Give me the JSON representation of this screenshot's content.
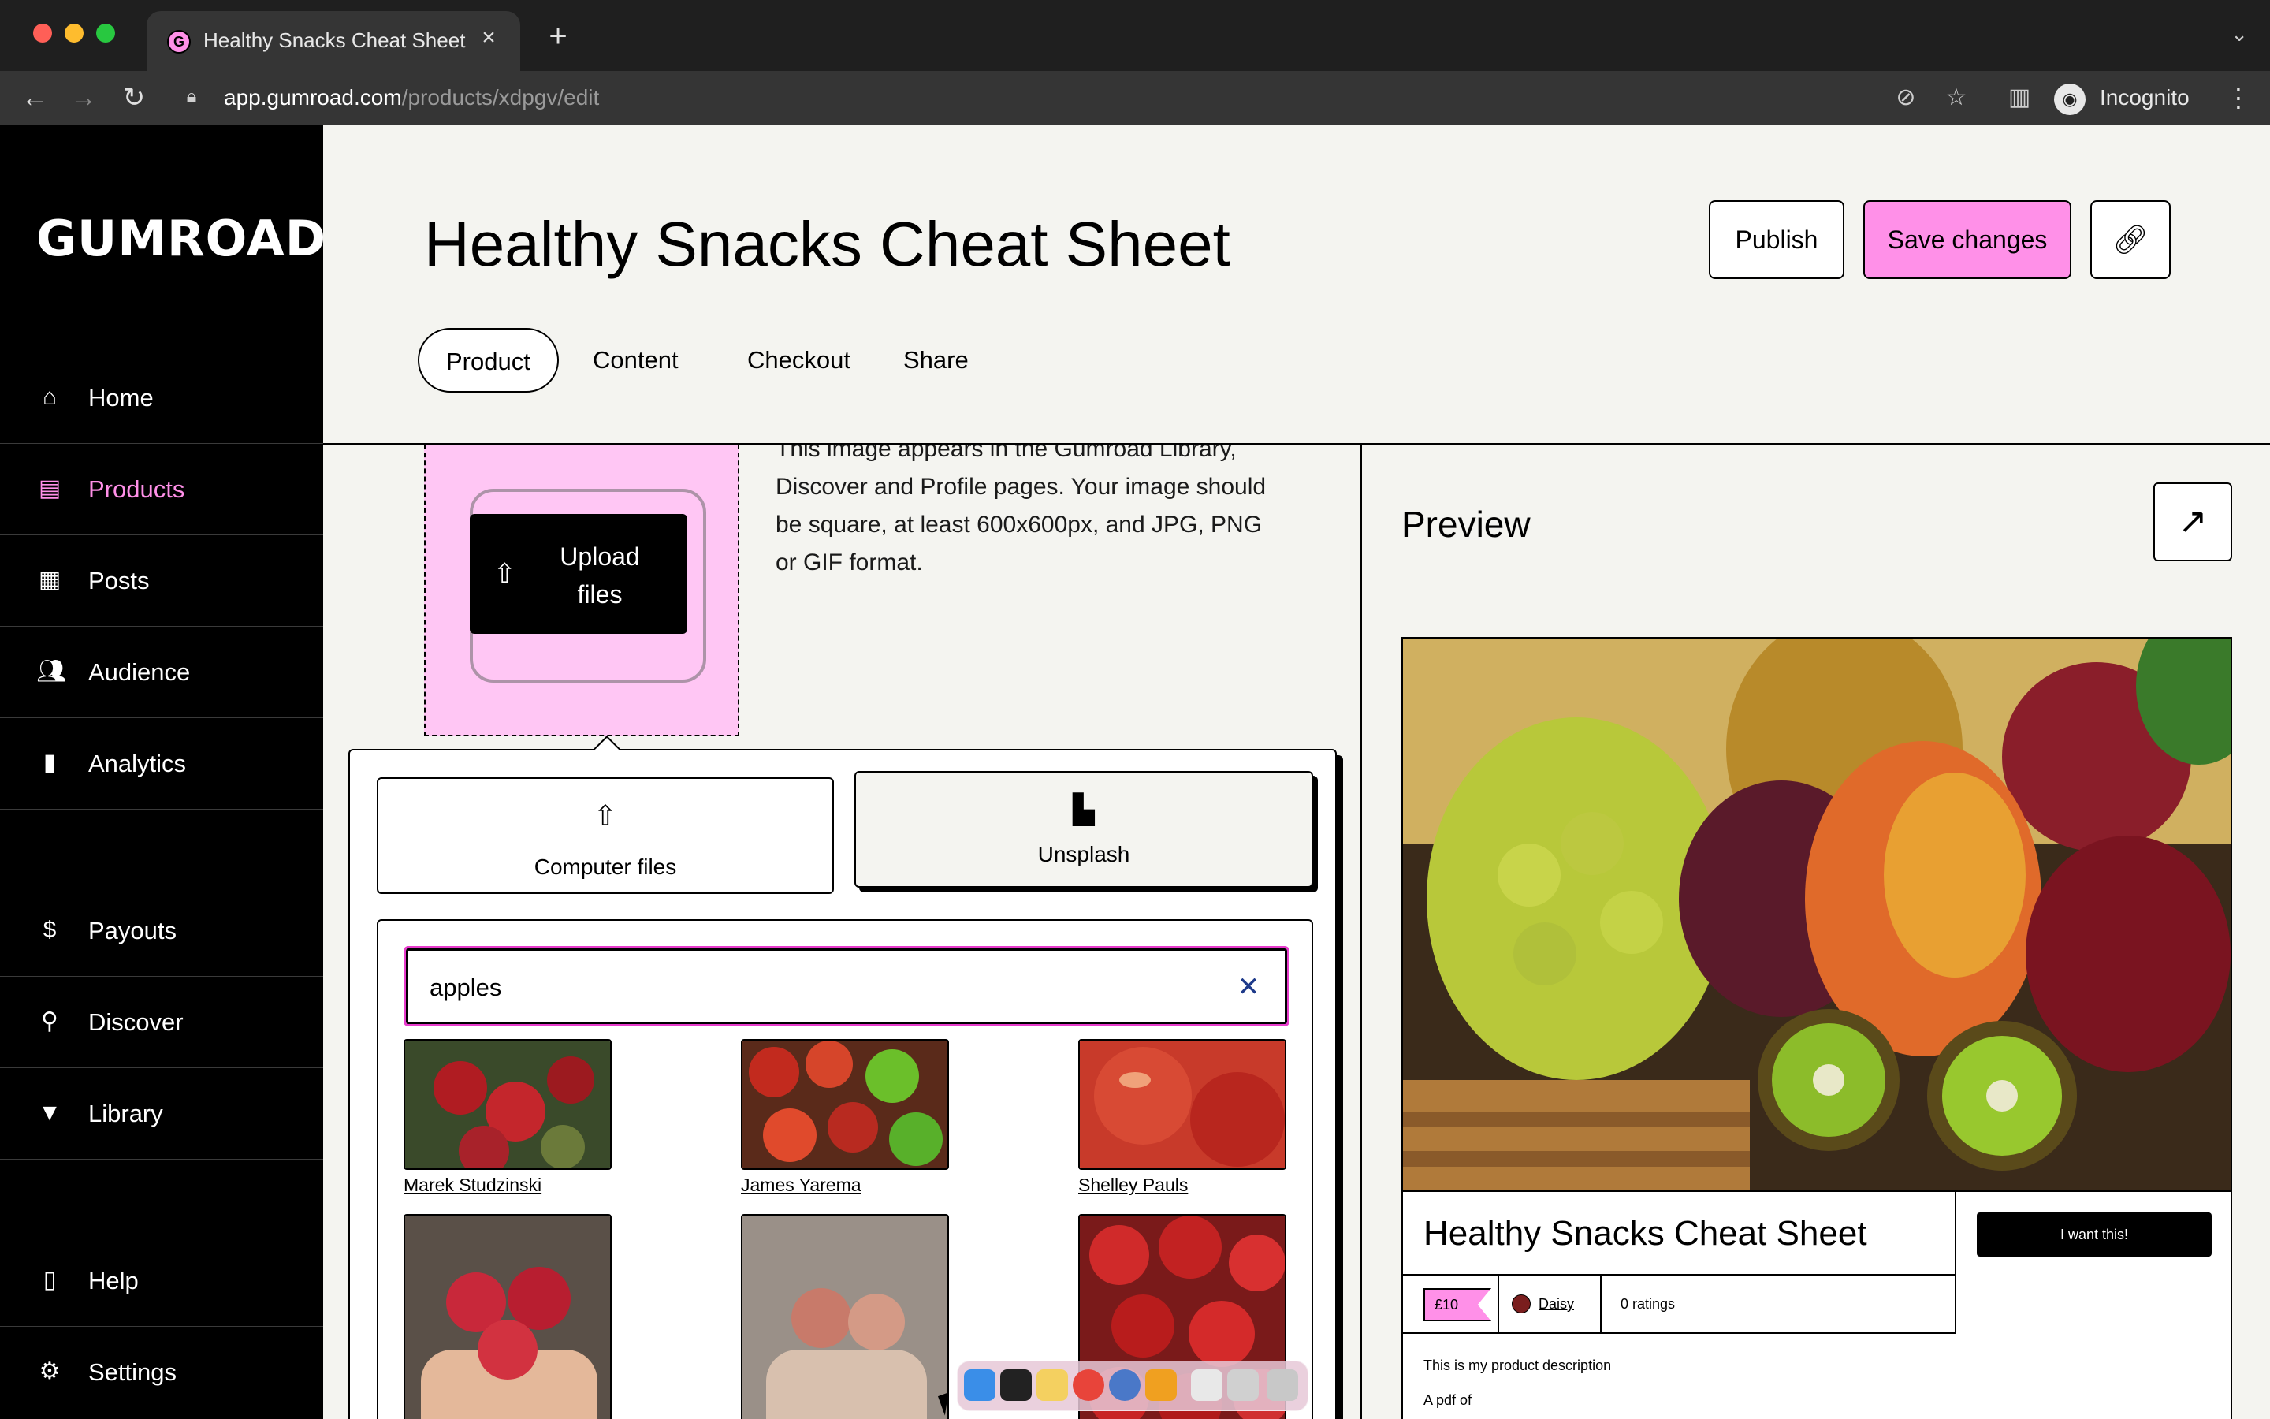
{
  "browser": {
    "tab_title": "Healthy Snacks Cheat Sheet",
    "url_host": "app.gumroad.com",
    "url_path": "/products/xdpgv/edit",
    "profile_label": "Incognito"
  },
  "sidebar": {
    "logo": "GUMROAD",
    "items": [
      {
        "label": "Home",
        "icon": "store-icon"
      },
      {
        "label": "Products",
        "icon": "archive-icon"
      },
      {
        "label": "Posts",
        "icon": "document-icon"
      },
      {
        "label": "Audience",
        "icon": "people-icon"
      },
      {
        "label": "Analytics",
        "icon": "bar-chart-icon"
      },
      {
        "label": "Payouts",
        "icon": "dollar-icon"
      },
      {
        "label": "Discover",
        "icon": "search-icon"
      },
      {
        "label": "Library",
        "icon": "bookmark-icon"
      },
      {
        "label": "Help",
        "icon": "book-icon"
      },
      {
        "label": "Settings",
        "icon": "gear-icon"
      }
    ],
    "active": "Products"
  },
  "header": {
    "title": "Healthy Snacks Cheat Sheet",
    "publish_label": "Publish",
    "save_label": "Save changes",
    "tabs": [
      "Product",
      "Content",
      "Checkout",
      "Share"
    ],
    "active_tab": "Product"
  },
  "editor": {
    "cover_help": "This image appears in the Gumroad Library, Discover and Profile pages. Your image should be square, at least 600x600px, and JPG, PNG or GIF format.",
    "upload_label": "Upload files",
    "source_tabs": [
      "Computer files",
      "Unsplash"
    ],
    "active_source": "Unsplash",
    "search_value": "apples",
    "photos": [
      {
        "credit": "Marek Studzinski"
      },
      {
        "credit": "James Yarema"
      },
      {
        "credit": "Shelley Pauls"
      },
      {
        "credit": ""
      },
      {
        "credit": ""
      },
      {
        "credit": ""
      }
    ]
  },
  "preview": {
    "title": "Preview",
    "product_title": "Healthy Snacks Cheat Sheet",
    "price": "£10",
    "creator": "Daisy",
    "ratings": "0 ratings",
    "buy_label": "I want this!",
    "description": "This is my product description",
    "description2": "A pdf of"
  },
  "colors": {
    "accent_pink": "#ff90e8",
    "sidebar_bg": "#000000",
    "page_bg": "#f4f4f0"
  }
}
